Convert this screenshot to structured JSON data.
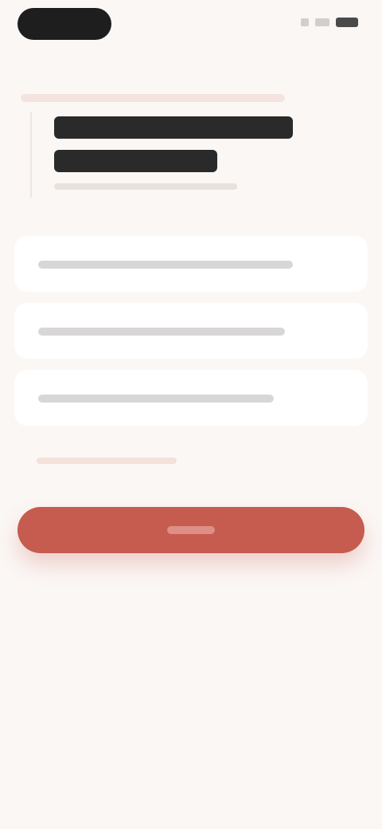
{
  "status_bar": {
    "icons": [
      "signal-icon",
      "wifi-icon",
      "battery-icon"
    ]
  },
  "question": {
    "title_lines": [
      "",
      ""
    ],
    "subtitle": ""
  },
  "options": [
    {
      "label": ""
    },
    {
      "label": ""
    },
    {
      "label": ""
    }
  ],
  "hint": "",
  "cta": {
    "label": ""
  },
  "colors": {
    "background": "#fbf7f5",
    "accent": "#c65b4f",
    "option_bg": "#ffffff"
  }
}
